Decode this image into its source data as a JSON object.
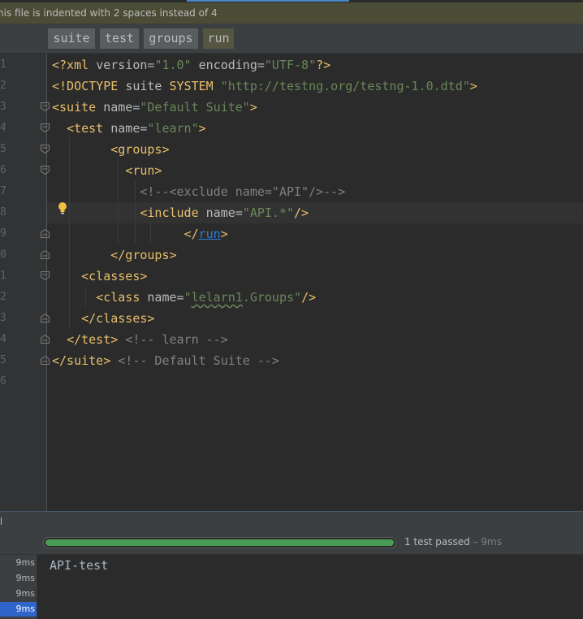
{
  "notification": {
    "text": "his file is indented with 2 spaces instead of 4"
  },
  "breadcrumbs": [
    "suite",
    "test",
    "groups",
    "run"
  ],
  "editor": {
    "line_numbers": [
      "1",
      "2",
      "3",
      "4",
      "5",
      "6",
      "7",
      "8",
      "9",
      "0",
      "1",
      "2",
      "3",
      "4",
      "5",
      "6"
    ],
    "lines": [
      {
        "indent": "",
        "tokens": [
          {
            "t": "tag",
            "v": "<?xml "
          },
          {
            "t": "attr",
            "v": "version"
          },
          {
            "t": "plain",
            "v": "="
          },
          {
            "t": "str",
            "v": "\"1.0\""
          },
          {
            "t": "plain",
            "v": " "
          },
          {
            "t": "attr",
            "v": "encoding"
          },
          {
            "t": "plain",
            "v": "="
          },
          {
            "t": "str",
            "v": "\"UTF-8\""
          },
          {
            "t": "tag",
            "v": "?>"
          }
        ]
      },
      {
        "indent": "",
        "tokens": [
          {
            "t": "tag",
            "v": "<!DOCTYPE "
          },
          {
            "t": "attr",
            "v": "suite "
          },
          {
            "t": "tag",
            "v": "SYSTEM "
          },
          {
            "t": "str",
            "v": "\"http://testng.org/testng-1.0.dtd\""
          },
          {
            "t": "tag",
            "v": ">"
          }
        ]
      },
      {
        "indent": "",
        "tokens": [
          {
            "t": "tag",
            "v": "<suite "
          },
          {
            "t": "attr",
            "v": "name"
          },
          {
            "t": "plain",
            "v": "="
          },
          {
            "t": "str",
            "v": "\"Default Suite\""
          },
          {
            "t": "tag",
            "v": ">"
          }
        ]
      },
      {
        "indent": "  ",
        "tokens": [
          {
            "t": "tag",
            "v": "<test "
          },
          {
            "t": "attr",
            "v": "name"
          },
          {
            "t": "plain",
            "v": "="
          },
          {
            "t": "str",
            "v": "\"learn\""
          },
          {
            "t": "tag",
            "v": ">"
          }
        ]
      },
      {
        "indent": "        ",
        "tokens": [
          {
            "t": "tag",
            "v": "<groups>"
          }
        ]
      },
      {
        "indent": "          ",
        "tokens": [
          {
            "t": "tag",
            "v": "<run>"
          }
        ]
      },
      {
        "indent": "            ",
        "tokens": [
          {
            "t": "cmt",
            "v": "<!--<exclude name=\"API\"/>-->"
          }
        ]
      },
      {
        "indent": "            ",
        "tokens": [
          {
            "t": "tag",
            "v": "<include "
          },
          {
            "t": "attr",
            "v": "name"
          },
          {
            "t": "plain",
            "v": "="
          },
          {
            "t": "str",
            "v": "\"API.*\""
          },
          {
            "t": "tag",
            "v": "/>"
          }
        ]
      },
      {
        "indent": "                  ",
        "tokens": [
          {
            "t": "tag",
            "v": "</"
          },
          {
            "t": "ref",
            "v": "run"
          },
          {
            "t": "tag",
            "v": ">"
          }
        ]
      },
      {
        "indent": "        ",
        "tokens": [
          {
            "t": "tag",
            "v": "</groups>"
          }
        ]
      },
      {
        "indent": "    ",
        "tokens": [
          {
            "t": "tag",
            "v": "<classes>"
          }
        ]
      },
      {
        "indent": "      ",
        "tokens": [
          {
            "t": "tag",
            "v": "<class "
          },
          {
            "t": "attr",
            "v": "name"
          },
          {
            "t": "plain",
            "v": "="
          },
          {
            "t": "str",
            "v": "\""
          },
          {
            "t": "typo",
            "v": "lelarn1"
          },
          {
            "t": "str",
            "v": ".Groups\""
          },
          {
            "t": "tag",
            "v": "/>"
          }
        ]
      },
      {
        "indent": "    ",
        "tokens": [
          {
            "t": "tag",
            "v": "</classes>"
          }
        ]
      },
      {
        "indent": "  ",
        "tokens": [
          {
            "t": "tag",
            "v": "</test>"
          },
          {
            "t": "plain",
            "v": " "
          },
          {
            "t": "cmt",
            "v": "<!-- learn -->"
          }
        ]
      },
      {
        "indent": "",
        "tokens": [
          {
            "t": "tag",
            "v": "</suite>"
          },
          {
            "t": "plain",
            "v": " "
          },
          {
            "t": "cmt",
            "v": "<!-- Default Suite -->"
          }
        ]
      },
      {
        "indent": "",
        "tokens": []
      }
    ]
  },
  "run_panel": {
    "progress": 1.0,
    "status": "1 test passed",
    "status_time": " – 9ms",
    "tree_rows": [
      "9ms",
      "9ms",
      "9ms",
      "9ms"
    ],
    "selected_row": 3,
    "console_output": "API-test"
  },
  "colors": {
    "accent_progress": "#499c54",
    "selection": "#2f65ca",
    "xml_tag": "#e8bf6a",
    "xml_string": "#6a8759",
    "comment": "#808080"
  }
}
